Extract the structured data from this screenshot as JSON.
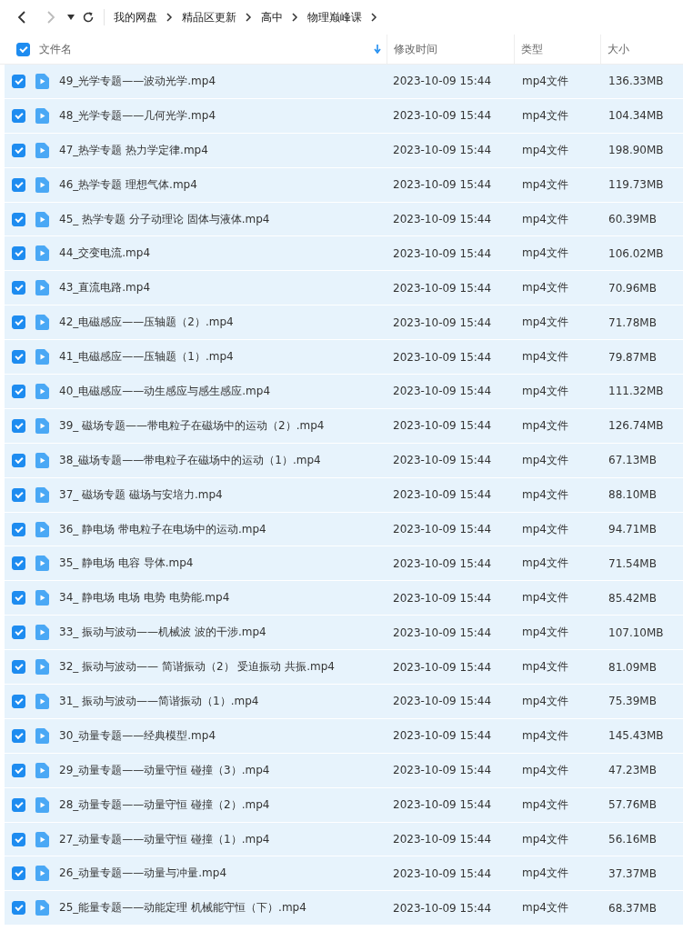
{
  "breadcrumb": [
    "我的网盘",
    "精品区更新",
    "高中",
    "物理巅峰课"
  ],
  "header": {
    "all_checked": true,
    "columns": [
      "文件名",
      "修改时间",
      "类型",
      "大小"
    ]
  },
  "rows": [
    {
      "name": "49_光学专题——波动光学.mp4",
      "date": "2023-10-09 15:44",
      "type": "mp4文件",
      "size": "136.33MB",
      "checked": true
    },
    {
      "name": "48_光学专题——几何光学.mp4",
      "date": "2023-10-09 15:44",
      "type": "mp4文件",
      "size": "104.34MB",
      "checked": true
    },
    {
      "name": "47_热学专题 热力学定律.mp4",
      "date": "2023-10-09 15:44",
      "type": "mp4文件",
      "size": "198.90MB",
      "checked": true
    },
    {
      "name": "46_热学专题 理想气体.mp4",
      "date": "2023-10-09 15:44",
      "type": "mp4文件",
      "size": "119.73MB",
      "checked": true
    },
    {
      "name": "45_ 热学专题 分子动理论 固体与液体.mp4",
      "date": "2023-10-09 15:44",
      "type": "mp4文件",
      "size": "60.39MB",
      "checked": true
    },
    {
      "name": "44_交变电流.mp4",
      "date": "2023-10-09 15:44",
      "type": "mp4文件",
      "size": "106.02MB",
      "checked": true
    },
    {
      "name": "43_直流电路.mp4",
      "date": "2023-10-09 15:44",
      "type": "mp4文件",
      "size": "70.96MB",
      "checked": true
    },
    {
      "name": "42_电磁感应——压轴题（2）.mp4",
      "date": "2023-10-09 15:44",
      "type": "mp4文件",
      "size": "71.78MB",
      "checked": true
    },
    {
      "name": "41_电磁感应——压轴题（1）.mp4",
      "date": "2023-10-09 15:44",
      "type": "mp4文件",
      "size": "79.87MB",
      "checked": true
    },
    {
      "name": "40_电磁感应——动生感应与感生感应.mp4",
      "date": "2023-10-09 15:44",
      "type": "mp4文件",
      "size": "111.32MB",
      "checked": true
    },
    {
      "name": "39_ 磁场专题——带电粒子在磁场中的运动（2）.mp4",
      "date": "2023-10-09 15:44",
      "type": "mp4文件",
      "size": "126.74MB",
      "checked": true
    },
    {
      "name": "38_磁场专题——带电粒子在磁场中的运动（1）.mp4",
      "date": "2023-10-09 15:44",
      "type": "mp4文件",
      "size": "67.13MB",
      "checked": true
    },
    {
      "name": "37_ 磁场专题 磁场与安培力.mp4",
      "date": "2023-10-09 15:44",
      "type": "mp4文件",
      "size": "88.10MB",
      "checked": true
    },
    {
      "name": "36_ 静电场 带电粒子在电场中的运动.mp4",
      "date": "2023-10-09 15:44",
      "type": "mp4文件",
      "size": "94.71MB",
      "checked": true
    },
    {
      "name": "35_ 静电场 电容 导体.mp4",
      "date": "2023-10-09 15:44",
      "type": "mp4文件",
      "size": "71.54MB",
      "checked": true
    },
    {
      "name": "34_ 静电场 电场 电势 电势能.mp4",
      "date": "2023-10-09 15:44",
      "type": "mp4文件",
      "size": "85.42MB",
      "checked": true
    },
    {
      "name": "33_ 振动与波动——机械波 波的干涉.mp4",
      "date": "2023-10-09 15:44",
      "type": "mp4文件",
      "size": "107.10MB",
      "checked": true
    },
    {
      "name": "32_ 振动与波动—— 简谐振动（2） 受迫振动 共振.mp4",
      "date": "2023-10-09 15:44",
      "type": "mp4文件",
      "size": "81.09MB",
      "checked": true
    },
    {
      "name": "31_ 振动与波动——简谐振动（1）.mp4",
      "date": "2023-10-09 15:44",
      "type": "mp4文件",
      "size": "75.39MB",
      "checked": true
    },
    {
      "name": "30_动量专题——经典模型.mp4",
      "date": "2023-10-09 15:44",
      "type": "mp4文件",
      "size": "145.43MB",
      "checked": true
    },
    {
      "name": "29_动量专题——动量守恒 碰撞（3）.mp4",
      "date": "2023-10-09 15:44",
      "type": "mp4文件",
      "size": "47.23MB",
      "checked": true
    },
    {
      "name": "28_动量专题——动量守恒 碰撞（2）.mp4",
      "date": "2023-10-09 15:44",
      "type": "mp4文件",
      "size": "57.76MB",
      "checked": true
    },
    {
      "name": "27_动量专题——动量守恒 碰撞（1）.mp4",
      "date": "2023-10-09 15:44",
      "type": "mp4文件",
      "size": "56.16MB",
      "checked": true
    },
    {
      "name": "26_动量专题——动量与冲量.mp4",
      "date": "2023-10-09 15:44",
      "type": "mp4文件",
      "size": "37.37MB",
      "checked": true
    },
    {
      "name": "25_能量专题——动能定理 机械能守恒（下）.mp4",
      "date": "2023-10-09 15:44",
      "type": "mp4文件",
      "size": "68.37MB",
      "checked": true
    }
  ]
}
